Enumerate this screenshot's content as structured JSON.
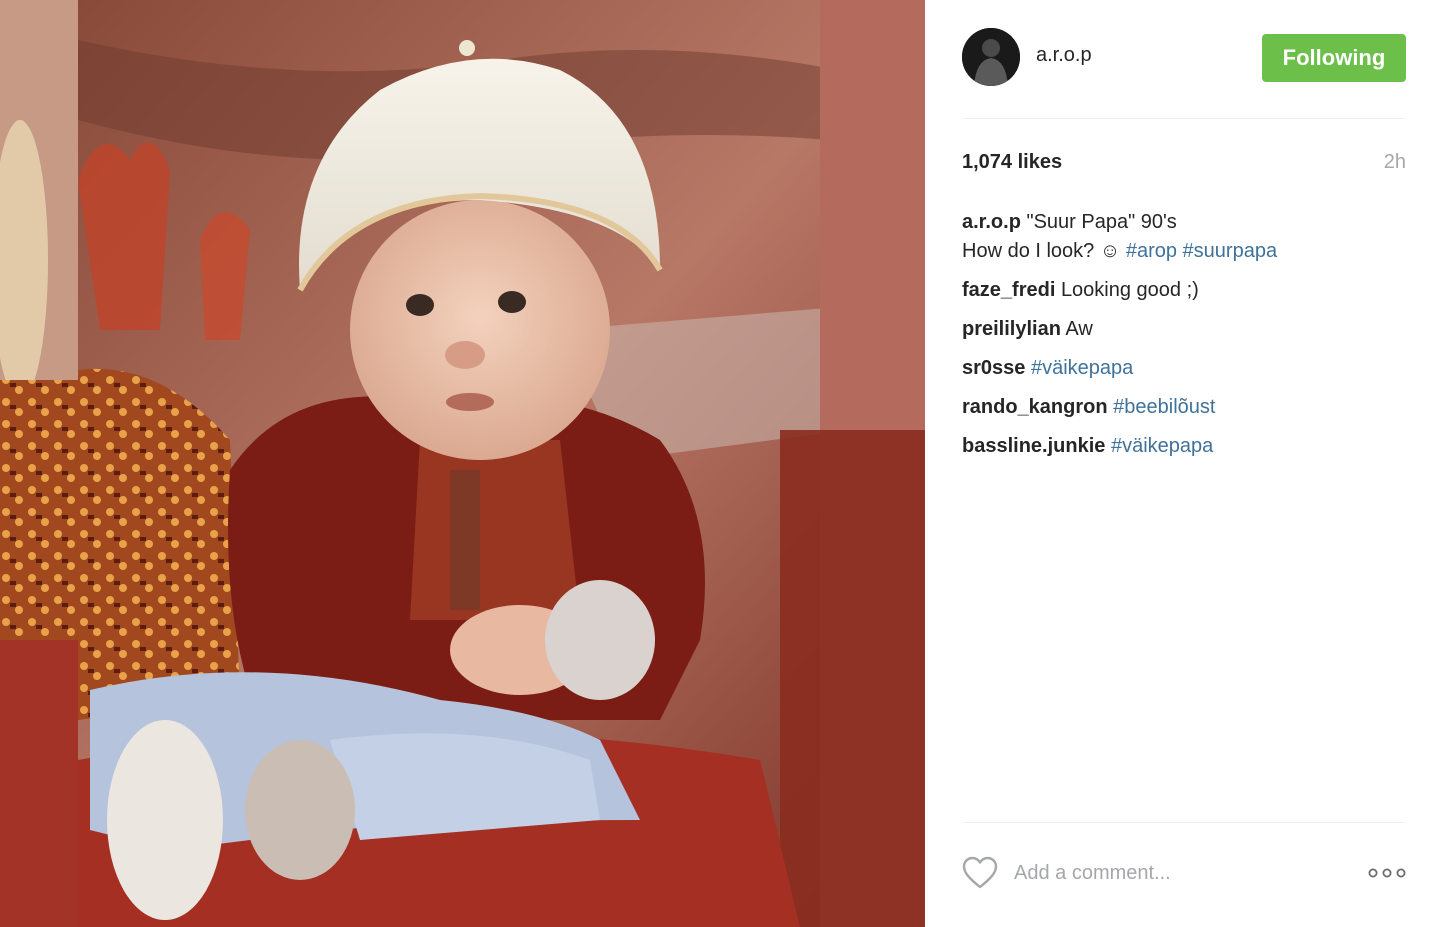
{
  "post": {
    "username": "a.r.o.p",
    "follow_label": "Following",
    "likes": "1,074 likes",
    "time_ago": "2h",
    "caption": {
      "user": "a.r.o.p",
      "line1": "\"Suur Papa\" 90's",
      "line2_text": "How do I look? ☺ ",
      "tags": [
        "#arop",
        "#suurpapa"
      ]
    },
    "comments": [
      {
        "user": "faze_fredi",
        "text": "Looking good ;)",
        "tag": ""
      },
      {
        "user": "preililylian",
        "text": "Aw",
        "tag": ""
      },
      {
        "user": "sr0sse",
        "text": "",
        "tag": "#väikepapa"
      },
      {
        "user": "rando_kangron",
        "text": "",
        "tag": "#beebilõust"
      },
      {
        "user": "bassline.junkie",
        "text": "",
        "tag": "#väikepapa"
      }
    ],
    "add_comment_placeholder": "Add a comment...",
    "icons": {
      "like": "heart-icon",
      "more": "more-options-icon"
    },
    "colors": {
      "follow_button": "#6cc04a",
      "hashtag": "#3f729b",
      "muted": "#a5a7aa"
    }
  }
}
